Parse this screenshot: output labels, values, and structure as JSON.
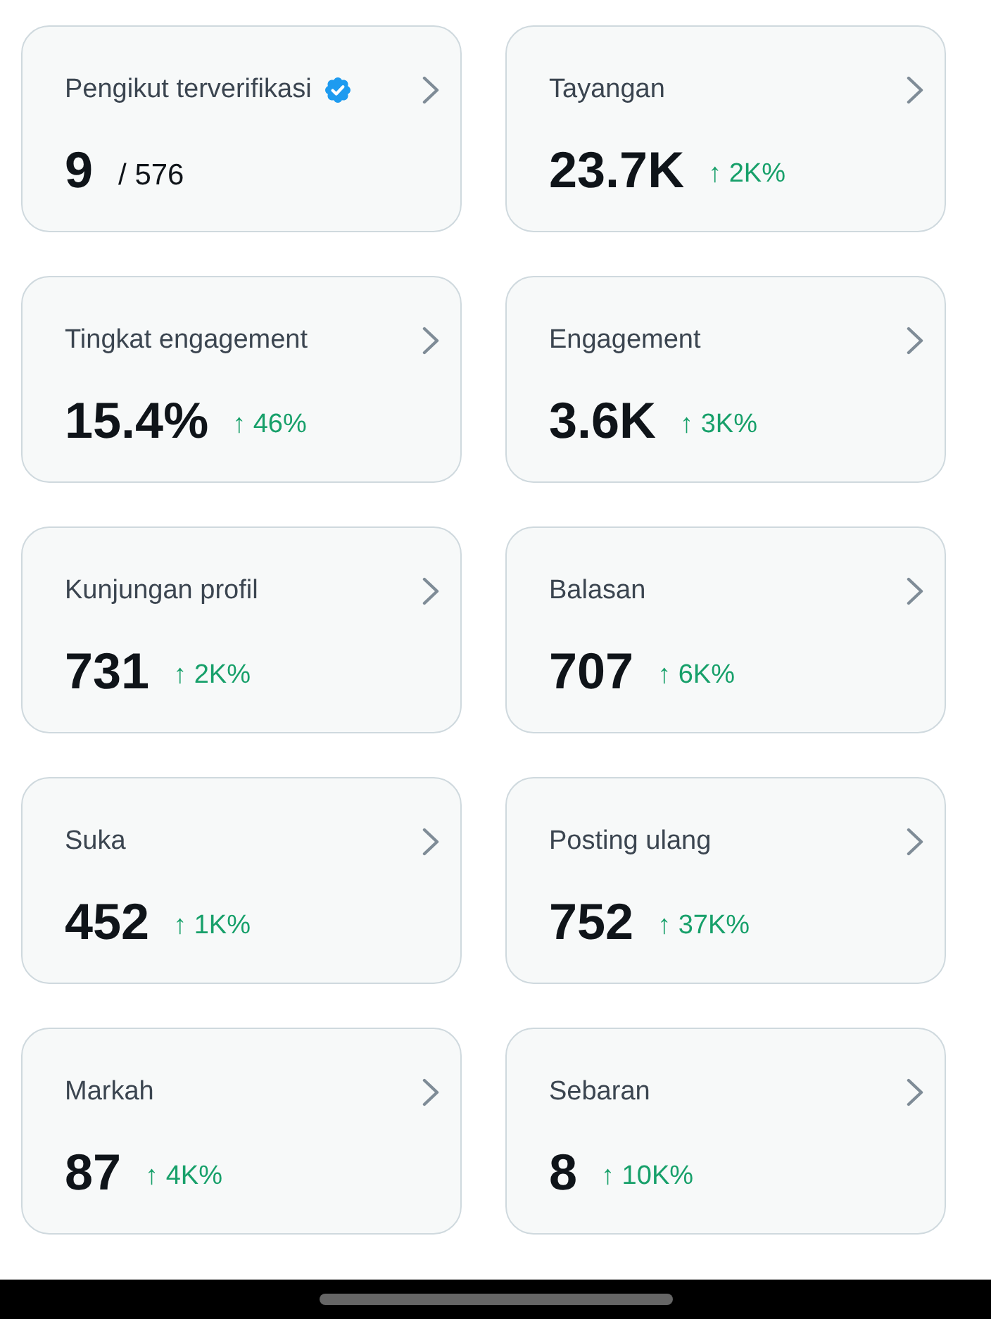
{
  "metrics": [
    {
      "kind": "ratio",
      "label": "Pengikut terverifikasi",
      "verified": true,
      "value": "9",
      "total": "/ 576"
    },
    {
      "kind": "change",
      "label": "Tayangan",
      "verified": false,
      "value": "23.7K",
      "change": "↑ 2K%"
    },
    {
      "kind": "change",
      "label": "Tingkat engagement",
      "verified": false,
      "value": "15.4%",
      "change": "↑ 46%"
    },
    {
      "kind": "change",
      "label": "Engagement",
      "verified": false,
      "value": "3.6K",
      "change": "↑ 3K%"
    },
    {
      "kind": "change",
      "label": "Kunjungan profil",
      "verified": false,
      "value": "731",
      "change": "↑ 2K%"
    },
    {
      "kind": "change",
      "label": "Balasan",
      "verified": false,
      "value": "707",
      "change": "↑ 6K%"
    },
    {
      "kind": "change",
      "label": "Suka",
      "verified": false,
      "value": "452",
      "change": "↑ 1K%"
    },
    {
      "kind": "change",
      "label": "Posting ulang",
      "verified": false,
      "value": "752",
      "change": "↑ 37K%"
    },
    {
      "kind": "change",
      "label": "Markah",
      "verified": false,
      "value": "87",
      "change": "↑ 4K%"
    },
    {
      "kind": "change",
      "label": "Sebaran",
      "verified": false,
      "value": "8",
      "change": "↑ 10K%"
    }
  ]
}
